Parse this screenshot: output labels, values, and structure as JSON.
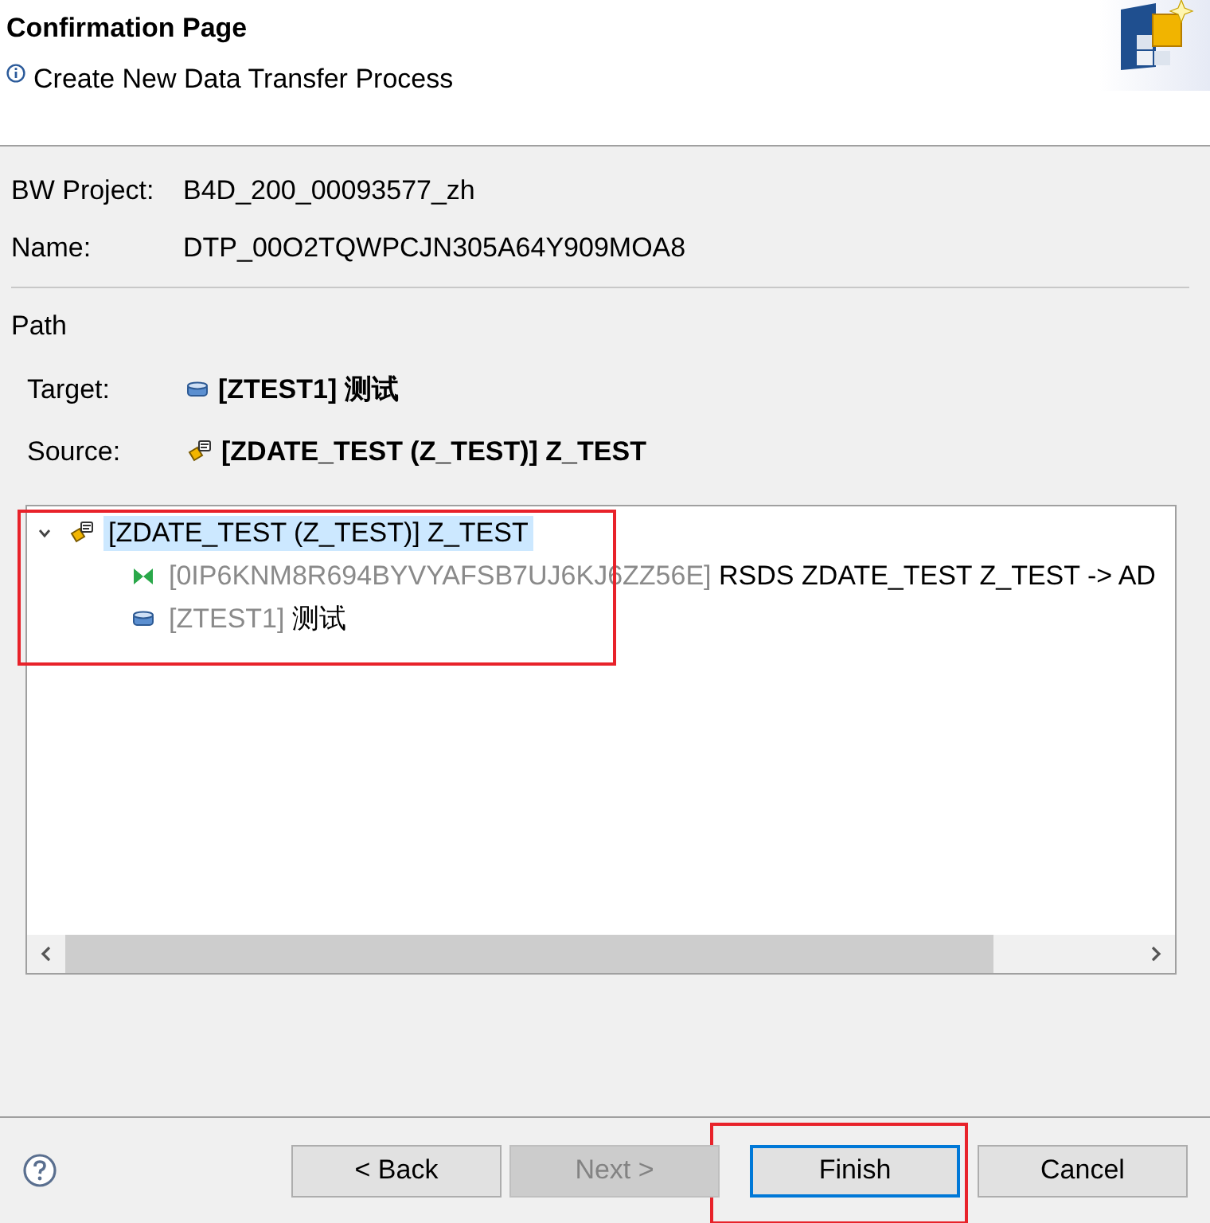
{
  "header": {
    "title": "Confirmation Page",
    "message": "Create New Data Transfer Process"
  },
  "fields": [
    {
      "label": "BW Project:",
      "value": "B4D_200_00093577_zh"
    },
    {
      "label": "Name:",
      "value": "DTP_00O2TQWPCJN305A64Y909MOA8"
    }
  ],
  "path": {
    "title": "Path",
    "rows": [
      {
        "label": "Target:",
        "kind": "datastore",
        "value": "[ZTEST1] 测试"
      },
      {
        "label": "Source:",
        "kind": "datasource",
        "value": "[ZDATE_TEST (Z_TEST)] Z_TEST"
      }
    ]
  },
  "tree": {
    "items": [
      {
        "kind": "datasource",
        "text": "[ZDATE_TEST (Z_TEST)] Z_TEST",
        "selected": true,
        "expanded": true,
        "children": [
          {
            "kind": "transformation",
            "id": "[0IP6KNM8R694BYVYAFSB7UJ6KJ6ZZ56E]",
            "text": "RSDS ZDATE_TEST Z_TEST -> AD",
            "selected": false
          },
          {
            "kind": "datastore",
            "id": "[ZTEST1]",
            "text": "测试",
            "selected": false
          }
        ]
      }
    ]
  },
  "annotations": [
    {
      "kind": "frame"
    },
    {
      "kind": "frame"
    }
  ],
  "buttons": [
    {
      "label": "< Back",
      "disabled": false,
      "default": false
    },
    {
      "label": "Next >",
      "disabled": true,
      "default": false
    },
    {
      "label": "Finish",
      "disabled": false,
      "default": true
    },
    {
      "label": "Cancel",
      "disabled": false,
      "default": false
    }
  ]
}
